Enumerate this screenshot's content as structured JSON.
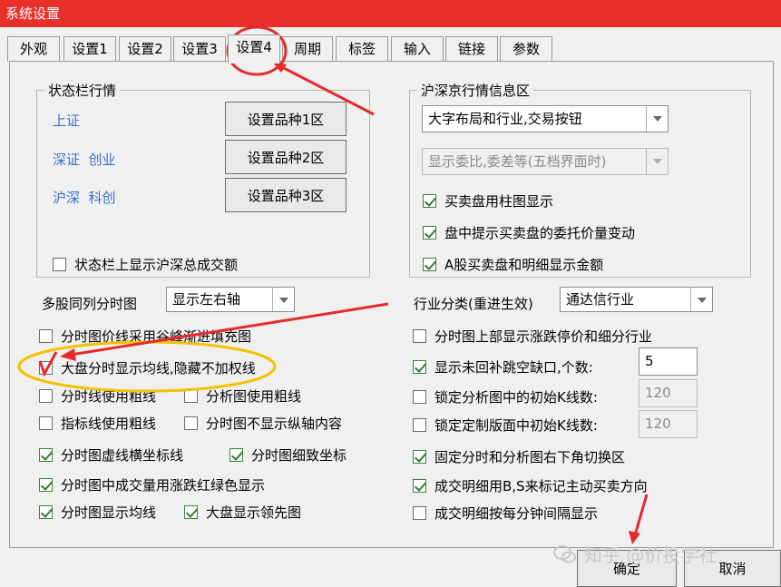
{
  "window": {
    "title": "系统设置"
  },
  "tabs": [
    "外观",
    "设置1",
    "设置2",
    "设置3",
    "设置4",
    "周期",
    "标签",
    "输入",
    "链接",
    "参数"
  ],
  "active_tab": "设置4",
  "status_bar_group": {
    "title": "状态栏行情",
    "rows": [
      {
        "label": "上证",
        "button": "设置品种1区"
      },
      {
        "label": "深证  创业",
        "button": "设置品种2区"
      },
      {
        "label": "沪深  科创",
        "button": "设置品种3区"
      }
    ],
    "checkbox": {
      "label": "状态栏上显示沪深总成交额",
      "checked": false
    }
  },
  "hs_group": {
    "title": "沪深京行情信息区",
    "select1": "大字布局和行业,交易按钮",
    "select2": "显示委比,委差等(五档界面时)",
    "checkboxes": [
      {
        "label": "买卖盘用柱图显示",
        "checked": true
      },
      {
        "label": "盘中提示买卖盘的委托价量变动",
        "checked": true
      },
      {
        "label": "A股买卖盘和明细显示金额",
        "checked": true
      }
    ]
  },
  "multi_stock": {
    "label": "多股同列分时图",
    "value": "显示左右轴"
  },
  "industry": {
    "label": "行业分类(重进生效)",
    "value": "通达信行业"
  },
  "left_options": [
    {
      "label": "分时图价线采用谷峰渐进填充图",
      "checked": false
    },
    {
      "label": "大盘分时显示均线,隐藏不加权线",
      "checked": false
    },
    {
      "label": "分时线使用粗线",
      "checked": false
    },
    {
      "label": "分析图使用粗线",
      "checked": false
    },
    {
      "label": "指标线使用粗线",
      "checked": false
    },
    {
      "label": "分时图不显示纵轴内容",
      "checked": false
    },
    {
      "label": "分时图虚线横坐标线",
      "checked": true
    },
    {
      "label": "分时图细致坐标",
      "checked": true
    },
    {
      "label": "分时图中成交量用涨跌红绿色显示",
      "checked": true
    },
    {
      "label": "分时图显示均线",
      "checked": true
    },
    {
      "label": "大盘显示领先图",
      "checked": true
    }
  ],
  "right_options": [
    {
      "label": "分时图上部显示涨跌停价和细分行业",
      "checked": false
    },
    {
      "label": "显示未回补跳空缺口,个数:",
      "checked": true,
      "value": "5"
    },
    {
      "label": "锁定分析图中的初始K线数:",
      "checked": false,
      "value": "120"
    },
    {
      "label": "锁定定制版面中初始K线数:",
      "checked": false,
      "value": "120"
    },
    {
      "label": "固定分时和分析图右下角切换区",
      "checked": true
    },
    {
      "label": "成交明细用B,S来标记主动买卖方向",
      "checked": true
    },
    {
      "label": "成交明细按每分钟间隔显示",
      "checked": false
    }
  ],
  "footer": {
    "ok": "确定",
    "cancel": "取消"
  },
  "watermark": "知乎 @价投学社",
  "colors": {
    "titlebar": "#e8302a",
    "annotation": "#e62a2a",
    "highlight": "#f2c200"
  }
}
